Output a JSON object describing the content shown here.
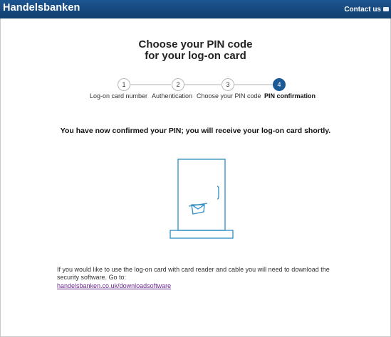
{
  "header": {
    "brand": "Handelsbanken",
    "contact_label": "Contact us"
  },
  "page": {
    "title_line1": "Choose your PIN code",
    "title_line2": "for your log-on card"
  },
  "stepper": {
    "steps": [
      {
        "number": "1",
        "label": "Log-on card number",
        "active": false
      },
      {
        "number": "2",
        "label": "Authentication",
        "active": false
      },
      {
        "number": "3",
        "label": "Choose your PIN code",
        "active": false
      },
      {
        "number": "4",
        "label": "PIN confirmation",
        "active": true
      }
    ],
    "active_color": "#1c5a96"
  },
  "confirmation": {
    "message": "You have now confirmed your PIN; you will receive your log-on card shortly."
  },
  "info": {
    "text": "If you would like to use the log-on card with card reader and cable you will need to download the security software. Go to:",
    "link_text": "handelsbanken.co.uk/downloadsoftware"
  },
  "colors": {
    "brand_bar": "#1c5590",
    "link": "#6b2a8f",
    "illustration": "#2d8dc4"
  },
  "icons": {
    "contact": "mail-icon",
    "illustration": "mailbox-door-icon"
  }
}
